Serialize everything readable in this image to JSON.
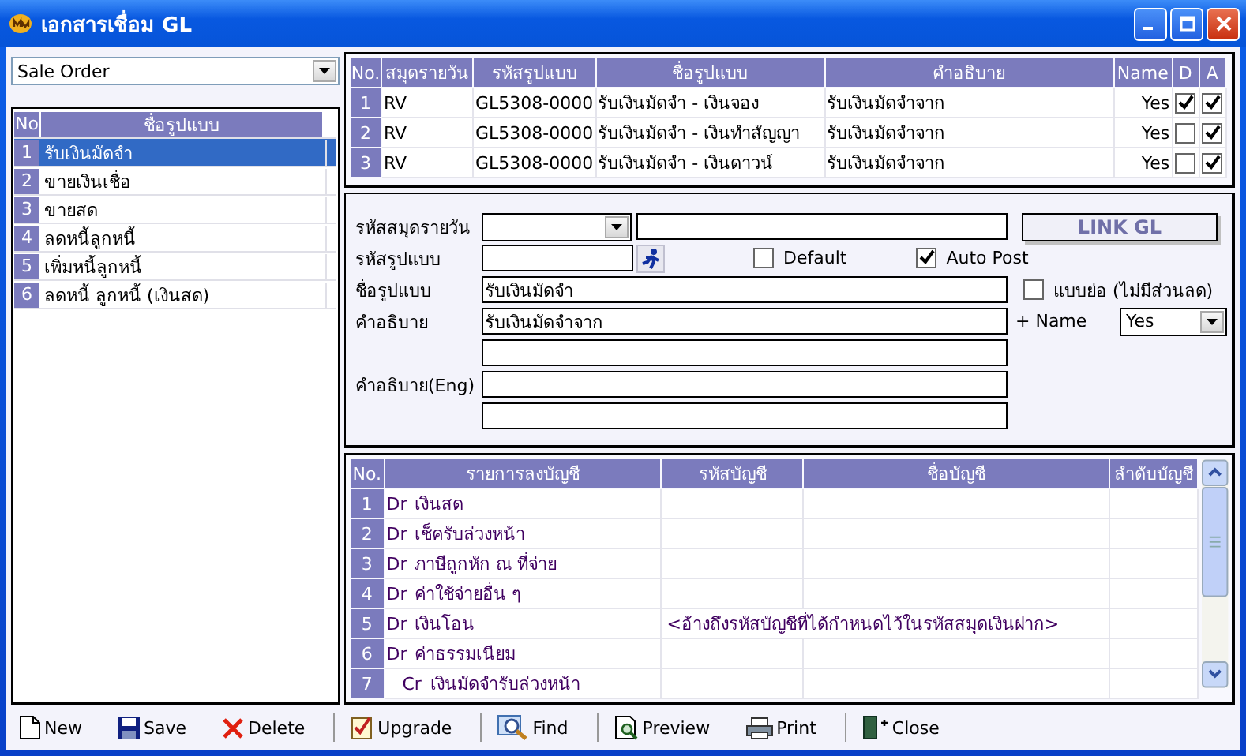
{
  "window": {
    "title": "เอกสารเชื่อม GL"
  },
  "filter": {
    "value": "Sale Order"
  },
  "template_list": {
    "columns": [
      "No",
      "ชื่อรูปแบบ"
    ],
    "rows": [
      {
        "no": "1",
        "name": "รับเงินมัดจำ",
        "selected": true
      },
      {
        "no": "2",
        "name": "ขายเงินเชื่อ",
        "selected": false
      },
      {
        "no": "3",
        "name": "ขายสด",
        "selected": false
      },
      {
        "no": "4",
        "name": "ลดหนี้ลูกหนี้",
        "selected": false
      },
      {
        "no": "5",
        "name": "เพิ่มหนี้ลูกหนี้",
        "selected": false
      },
      {
        "no": "6",
        "name": "ลดหนี้ ลูกหนี้ (เงินสด)",
        "selected": false
      }
    ]
  },
  "link_table": {
    "columns": [
      "No.",
      "สมุดรายวัน",
      "รหัสรูปแบบ",
      "ชื่อรูปแบบ",
      "คำอธิบาย",
      "Name",
      "D",
      "A"
    ],
    "rows": [
      {
        "no": "1",
        "journal": "RV",
        "code": "GL5308-0000",
        "name": "รับเงินมัดจำ - เงินจอง",
        "description": "รับเงินมัดจำจาก",
        "name_flag": "Yes",
        "d": true,
        "a": true
      },
      {
        "no": "2",
        "journal": "RV",
        "code": "GL5308-0000",
        "name": "รับเงินมัดจำ - เงินทำสัญญา",
        "description": "รับเงินมัดจำจาก",
        "name_flag": "Yes",
        "d": false,
        "a": true
      },
      {
        "no": "3",
        "journal": "RV",
        "code": "GL5308-0000",
        "name": "รับเงินมัดจำ - เงินดาวน์",
        "description": "รับเงินมัดจำจาก",
        "name_flag": "Yes",
        "d": false,
        "a": true
      }
    ]
  },
  "form": {
    "journal_label": "รหัสสมุดรายวัน",
    "link_button": "LINK GL",
    "template_code_label": "รหัสรูปแบบ",
    "default": {
      "label": "Default",
      "checked": false
    },
    "auto_post": {
      "label": "Auto Post",
      "checked": true
    },
    "template_name": {
      "label": "ชื่อรูปแบบ",
      "value": "รับเงินมัดจำ"
    },
    "short_form": {
      "label": "แบบย่อ (ไม่มีส่วนลด)",
      "checked": false
    },
    "description": {
      "label": "คำอธิบาย",
      "value": "รับเงินมัดจำจาก"
    },
    "name_option": {
      "label": "+ Name",
      "value": "Yes"
    },
    "description_eng_label": "คำอธิบาย(Eng)"
  },
  "entries_table": {
    "columns": [
      "No.",
      "รายการลงบัญชี",
      "รหัสบัญชี",
      "ชื่อบัญชี",
      "ลำดับบัญชี"
    ],
    "rows": [
      {
        "no": "1",
        "kind": "debit",
        "side": "Dr",
        "entry": "เงินสด"
      },
      {
        "no": "2",
        "kind": "debit",
        "side": "Dr",
        "entry": "เช็ครับล่วงหน้า"
      },
      {
        "no": "3",
        "kind": "debit",
        "side": "Dr",
        "entry": "ภาษีถูกหัก ณ ที่จ่าย"
      },
      {
        "no": "4",
        "kind": "debit",
        "side": "Dr",
        "entry": "ค่าใช้จ่ายอื่น ๆ"
      },
      {
        "no": "5",
        "kind": "debit",
        "side": "Dr",
        "entry": "เงินโอน",
        "code": "<อ้างถึงรหัสบัญชีที่ได้กำหนดไว้ในรหัสสมุดเงินฝาก>"
      },
      {
        "no": "6",
        "kind": "debit",
        "side": "Dr",
        "entry": "ค่าธรรมเนียม"
      },
      {
        "no": "7",
        "kind": "credit",
        "side": "Cr",
        "entry": "เงินมัดจำรับล่วงหน้า"
      }
    ]
  },
  "toolbar": {
    "groups": [
      [
        {
          "kind": "new",
          "label": "New"
        },
        {
          "kind": "save",
          "label": "Save"
        },
        {
          "kind": "delete",
          "label": "Delete"
        }
      ],
      [
        {
          "kind": "upgrade",
          "label": "Upgrade"
        }
      ],
      [
        {
          "kind": "find",
          "label": "Find"
        }
      ],
      [
        {
          "kind": "preview",
          "label": "Preview"
        },
        {
          "kind": "print",
          "label": "Print"
        }
      ],
      [
        {
          "kind": "close",
          "label": "Close"
        }
      ]
    ]
  }
}
